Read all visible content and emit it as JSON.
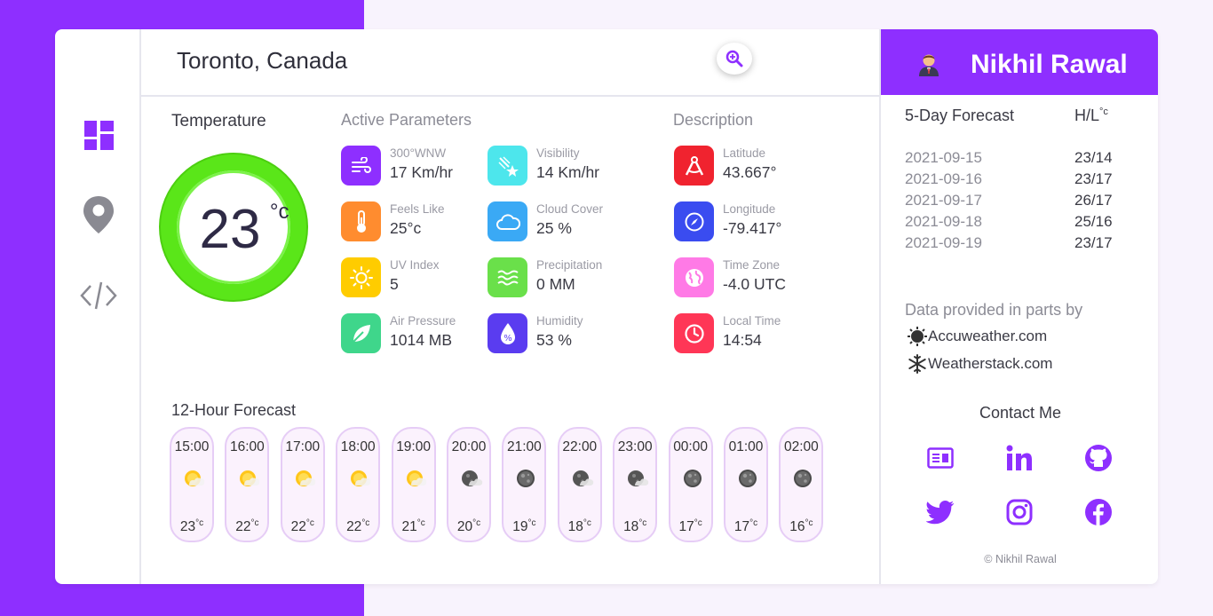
{
  "header": {
    "city": "Toronto, Canada",
    "search_icon": "search-icon"
  },
  "sidebar": {
    "items": [
      {
        "icon": "dashboard-icon"
      },
      {
        "icon": "location-pin-icon"
      },
      {
        "icon": "code-icon"
      }
    ]
  },
  "temperature": {
    "label": "Temperature",
    "value": "23",
    "unit": "°c",
    "ring_color": "#5ae619"
  },
  "active_parameters": {
    "title": "Active Parameters",
    "items": [
      {
        "label": "300°WNW",
        "value": "17 Km/hr",
        "icon": "wind-icon",
        "color": "#8e2fff"
      },
      {
        "label": "Visibility",
        "value": "14 Km/hr",
        "icon": "meteor-icon",
        "color": "#4de6ec"
      },
      {
        "label": "Feels Like",
        "value": "25°c",
        "icon": "thermometer-icon",
        "color": "#ff8c2f"
      },
      {
        "label": "Cloud Cover",
        "value": "25 %",
        "icon": "cloud-icon",
        "color": "#3aa9f5"
      },
      {
        "label": "UV Index",
        "value": "5",
        "icon": "sun-icon",
        "color": "#ffcc00"
      },
      {
        "label": "Precipitation",
        "value": "0 MM",
        "icon": "waves-icon",
        "color": "#6ae04a"
      },
      {
        "label": "Air Pressure",
        "value": "1014 MB",
        "icon": "leaf-icon",
        "color": "#3fd68b"
      },
      {
        "label": "Humidity",
        "value": "53 %",
        "icon": "humidity-drop-icon",
        "color": "#5a3cf0"
      }
    ]
  },
  "description": {
    "title": "Description",
    "items": [
      {
        "label": "Latitude",
        "value": "43.667°",
        "icon": "compass-drafting-icon",
        "color": "#f0232f"
      },
      {
        "label": "Longitude",
        "value": "-79.417°",
        "icon": "compass-icon",
        "color": "#3a4cf0"
      },
      {
        "label": "Time Zone",
        "value": "-4.0 UTC",
        "icon": "globe-icon",
        "color": "#ff7ae6"
      },
      {
        "label": "Local Time",
        "value": "14:54",
        "icon": "clock-icon",
        "color": "#ff3656"
      }
    ]
  },
  "hourly": {
    "title": "12-Hour Forecast",
    "items": [
      {
        "time": "15:00",
        "temp": "23",
        "unit": "°c",
        "icon": "sun-cloud-icon"
      },
      {
        "time": "16:00",
        "temp": "22",
        "unit": "°c",
        "icon": "sun-cloud-icon"
      },
      {
        "time": "17:00",
        "temp": "22",
        "unit": "°c",
        "icon": "sun-cloud-icon"
      },
      {
        "time": "18:00",
        "temp": "22",
        "unit": "°c",
        "icon": "sun-cloud-icon"
      },
      {
        "time": "19:00",
        "temp": "21",
        "unit": "°c",
        "icon": "sun-cloud-icon"
      },
      {
        "time": "20:00",
        "temp": "20",
        "unit": "°c",
        "icon": "moon-cloud-icon"
      },
      {
        "time": "21:00",
        "temp": "19",
        "unit": "°c",
        "icon": "moon-icon"
      },
      {
        "time": "22:00",
        "temp": "18",
        "unit": "°c",
        "icon": "moon-cloud-icon"
      },
      {
        "time": "23:00",
        "temp": "18",
        "unit": "°c",
        "icon": "moon-cloud-icon"
      },
      {
        "time": "00:00",
        "temp": "17",
        "unit": "°c",
        "icon": "moon-icon"
      },
      {
        "time": "01:00",
        "temp": "17",
        "unit": "°c",
        "icon": "moon-icon"
      },
      {
        "time": "02:00",
        "temp": "16",
        "unit": "°c",
        "icon": "moon-icon"
      }
    ]
  },
  "profile": {
    "name": "Nikhil Rawal",
    "avatar_icon": "avatar-icon"
  },
  "forecast": {
    "title": "5-Day Forecast",
    "hl_label": "H/L",
    "hl_unit": "°c",
    "rows": [
      {
        "date": "2021-09-15",
        "hl": "23/14"
      },
      {
        "date": "2021-09-16",
        "hl": "23/17"
      },
      {
        "date": "2021-09-17",
        "hl": "26/17"
      },
      {
        "date": "2021-09-18",
        "hl": "25/16"
      },
      {
        "date": "2021-09-19",
        "hl": "23/17"
      }
    ]
  },
  "providers": {
    "title": "Data provided in parts by",
    "items": [
      {
        "name": "Accuweather.com",
        "icon": "sun-gear-icon"
      },
      {
        "name": "Weatherstack.com",
        "icon": "snowflake-icon"
      }
    ]
  },
  "contact": {
    "title": "Contact Me",
    "links": [
      {
        "icon": "resume-icon"
      },
      {
        "icon": "linkedin-icon"
      },
      {
        "icon": "github-icon"
      },
      {
        "icon": "twitter-icon"
      },
      {
        "icon": "instagram-icon"
      },
      {
        "icon": "facebook-icon"
      }
    ]
  },
  "footer": {
    "copyright": "© Nikhil Rawal"
  },
  "colors": {
    "accent": "#8e2fff",
    "background": "#f8f3fd"
  }
}
